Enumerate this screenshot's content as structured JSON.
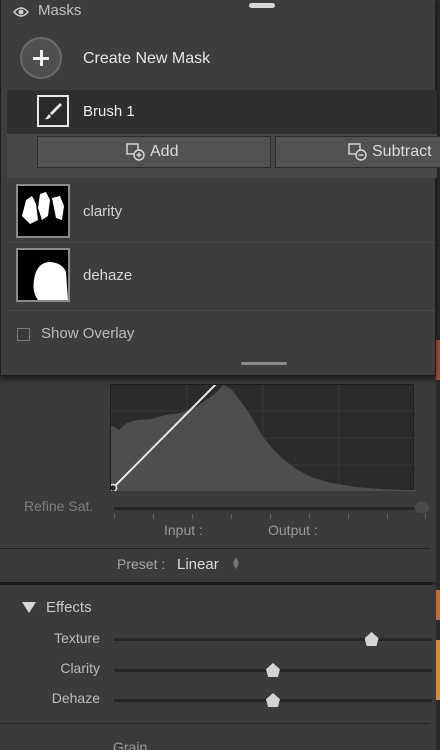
{
  "masks_panel": {
    "title": "Masks",
    "create_label": "Create New Mask",
    "brush": {
      "label": "Brush 1"
    },
    "add_label": "Add",
    "subtract_label": "Subtract",
    "items": [
      {
        "label": "clarity"
      },
      {
        "label": "dehaze"
      }
    ],
    "show_overlay_label": "Show Overlay"
  },
  "curve": {
    "refine_label": "Refine Sat.",
    "input_label": "Input :",
    "output_label": "Output :",
    "preset_label": "Preset :",
    "preset_value": "Linear"
  },
  "effects": {
    "title": "Effects",
    "sliders": [
      {
        "label": "Texture",
        "level": 0.81
      },
      {
        "label": "Clarity",
        "level": 0.5
      },
      {
        "label": "Dehaze",
        "level": 0.5
      }
    ],
    "grain_label": "Grain"
  },
  "colors": {
    "panel_bg": "#3d3d3d",
    "selected_row": "#2f2f2f",
    "accent_orange": "#d46a28"
  }
}
